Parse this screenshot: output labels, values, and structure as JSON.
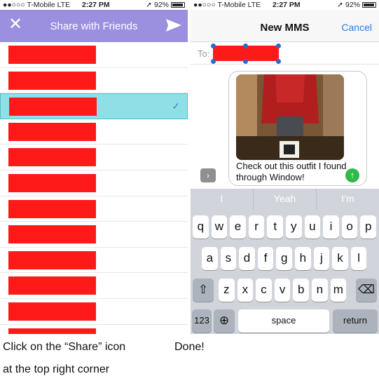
{
  "left_screen": {
    "status": {
      "carrier": "●●○○○ T-Mobile  LTE",
      "time": "2:27 PM",
      "battery": "92%"
    },
    "header": {
      "title": "Share with Friends",
      "close_icon": "close-icon",
      "send_icon": "paper-plane-icon"
    },
    "contacts": [
      {
        "selected": false
      },
      {
        "selected": false
      },
      {
        "selected": true
      },
      {
        "selected": false
      },
      {
        "selected": false
      },
      {
        "selected": false
      },
      {
        "selected": false
      },
      {
        "selected": false
      },
      {
        "selected": false
      },
      {
        "selected": false
      },
      {
        "selected": false
      },
      {
        "selected": false
      }
    ],
    "selected_check": "✓"
  },
  "right_screen": {
    "status": {
      "carrier": "●●○○○ T-Mobile  LTE",
      "time": "2:27 PM",
      "battery": "92%"
    },
    "header": {
      "title": "New MMS",
      "cancel": "Cancel"
    },
    "to_label": "To:",
    "message": "Check out this outfit I found through Window!",
    "keyboard": {
      "suggestions": [
        "I",
        "Yeah",
        "I'm"
      ],
      "row1": [
        "q",
        "w",
        "e",
        "r",
        "t",
        "y",
        "u",
        "i",
        "o",
        "p"
      ],
      "row2": [
        "a",
        "s",
        "d",
        "f",
        "g",
        "h",
        "j",
        "k",
        "l"
      ],
      "row3": [
        "z",
        "x",
        "c",
        "v",
        "b",
        "n",
        "m"
      ],
      "numbers": "123",
      "space": "space",
      "return": "return"
    }
  },
  "captions": {
    "left_line1": "Click on the “Share” icon",
    "left_line2": "at the top right corner",
    "right": "Done!"
  },
  "colors": {
    "header_purple": "#9b8fe0",
    "redaction": "#ff1a1a",
    "selected_row": "#8fe0e6",
    "link_blue": "#2a7de1"
  }
}
